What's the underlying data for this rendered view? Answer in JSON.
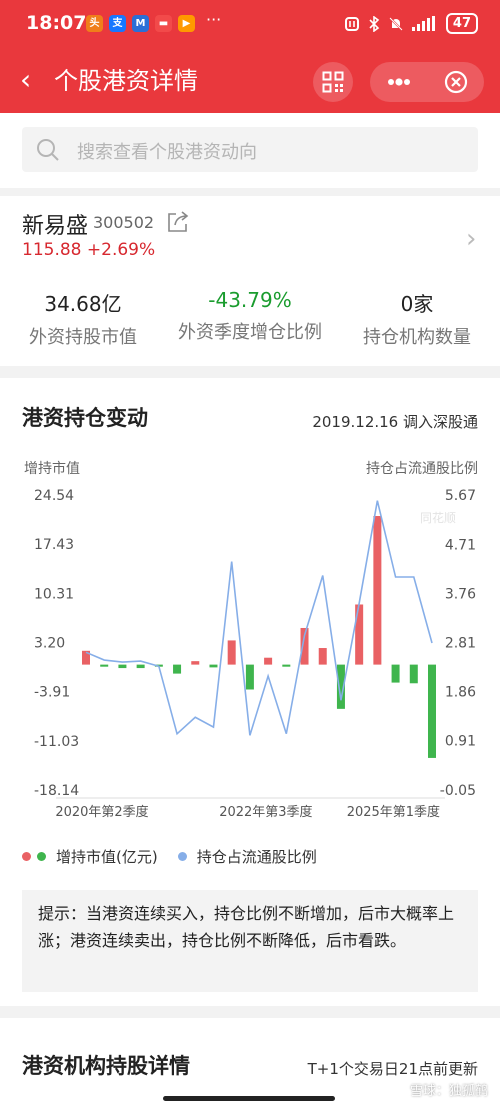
{
  "status_bar": {
    "time": "18:07",
    "apps": [
      {
        "icon": "news-app-icon",
        "glyph": "头",
        "color": "#f07e1a"
      },
      {
        "icon": "alipay-icon",
        "glyph": "支",
        "color": "#1677ff"
      },
      {
        "icon": "mail-app-icon",
        "glyph": "M",
        "color": "#2b6fd6"
      },
      {
        "icon": "message-app-icon",
        "glyph": "▬",
        "color": "#f24a4a"
      },
      {
        "icon": "video-app-icon",
        "glyph": "▶",
        "color": "#ff9900"
      }
    ],
    "more": "···",
    "battery": "47"
  },
  "nav": {
    "back": "‹",
    "title": "个股港资详情"
  },
  "search": {
    "placeholder": "搜索查看个股港资动向"
  },
  "stock": {
    "name": "新易盛",
    "code": "300502",
    "price_change": "115.88 +2.69%",
    "stats": [
      {
        "value": "34.68亿",
        "label": "外资持股市值"
      },
      {
        "value": "-43.79%",
        "label": "外资季度增仓比例"
      },
      {
        "value": "0家",
        "label": "持仓机构数量"
      }
    ]
  },
  "holding_chart": {
    "title": "港资持仓变动",
    "event": "2019.12.16 调入深股通",
    "left_axis_title": "增持市值",
    "right_axis_title": "持仓占流通股比例",
    "watermark": "同花顺",
    "legend": {
      "bar_label": "增持市值(亿元)",
      "line_label": "持仓占流通股比例"
    }
  },
  "chart_data": {
    "type": "bar",
    "series": [
      {
        "name": "增持市值(亿元)",
        "type": "bar",
        "axis": "left",
        "values": [
          2.0,
          -0.3,
          -0.5,
          -0.5,
          -0.3,
          -1.3,
          0.5,
          -0.4,
          3.5,
          -3.6,
          1.0,
          -0.3,
          5.3,
          2.4,
          -6.4,
          8.7,
          21.5,
          -2.6,
          -2.7,
          -13.5
        ]
      },
      {
        "name": "持仓占流通股比例",
        "type": "line",
        "axis": "right",
        "values": [
          2.62,
          2.47,
          2.43,
          2.45,
          2.35,
          1.04,
          1.36,
          1.17,
          4.38,
          1.01,
          2.16,
          1.04,
          2.95,
          4.11,
          1.69,
          3.57,
          5.56,
          4.08,
          4.08,
          2.8
        ]
      }
    ],
    "x_tick_labels": [
      "2020年第2季度",
      "2022年第3季度",
      "2025年第1季度"
    ],
    "left_axis": {
      "ticks": [
        "24.54",
        "17.43",
        "10.31",
        "3.20",
        "-3.91",
        "-11.03",
        "-18.14"
      ],
      "range": [
        -18.14,
        24.54
      ]
    },
    "right_axis": {
      "ticks": [
        "5.67",
        "4.71",
        "3.76",
        "2.81",
        "1.86",
        "0.91",
        "-0.05"
      ],
      "range": [
        -0.05,
        5.67
      ]
    },
    "up_color": "#e96164",
    "down_color": "#3fb54d",
    "line_color": "#86aee8",
    "grid": false
  },
  "tip": "提示：当港资连续买入，持仓比例不断增加，后市大概率上涨；港资连续卖出，持仓比例不断降低，后市看跌。",
  "institutions": {
    "title": "港资机构持股详情",
    "note": "T+1个交易日21点前更新"
  },
  "footer_watermark": "雪球：独孤鹤",
  "colors": {
    "brand_red": "#e9383d",
    "price_up": "#d7282f",
    "value_down": "#1a9c2e"
  }
}
